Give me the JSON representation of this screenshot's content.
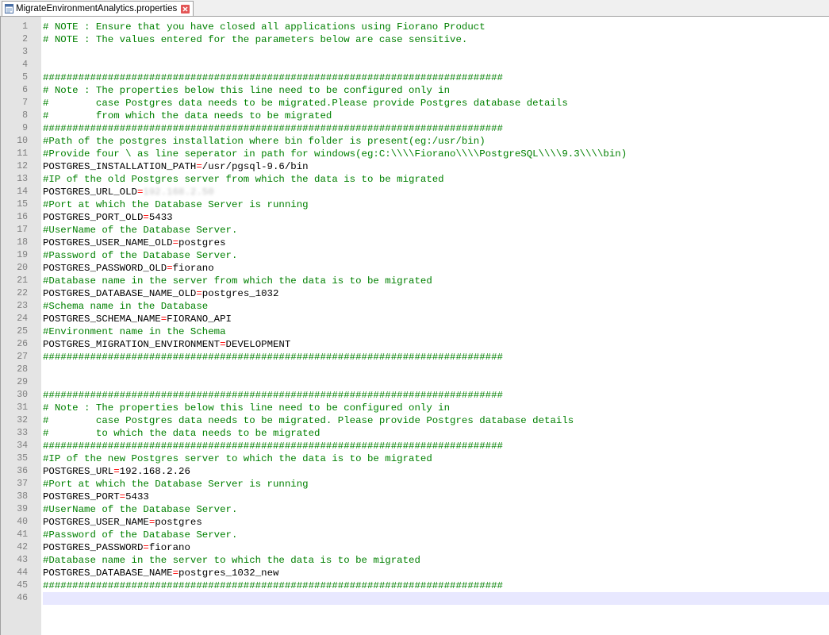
{
  "tab": {
    "filename": "MigrateEnvironmentAnalytics.properties",
    "file_icon": "properties-file-icon",
    "close_icon": "close-icon"
  },
  "editor": {
    "current_line": 46,
    "lines": [
      {
        "n": "1",
        "type": "comment",
        "text": "# NOTE : Ensure that you have closed all applications using Fiorano Product"
      },
      {
        "n": "2",
        "type": "comment",
        "text": "# NOTE : The values entered for the parameters below are case sensitive."
      },
      {
        "n": "3",
        "type": "blank",
        "text": ""
      },
      {
        "n": "4",
        "type": "blank",
        "text": ""
      },
      {
        "n": "5",
        "type": "comment",
        "text": "##############################################################################"
      },
      {
        "n": "6",
        "type": "comment",
        "text": "# Note : The properties below this line need to be configured only in"
      },
      {
        "n": "7",
        "type": "comment",
        "text": "#        case Postgres data needs to be migrated.Please provide Postgres database details"
      },
      {
        "n": "8",
        "type": "comment",
        "text": "#        from which the data needs to be migrated"
      },
      {
        "n": "9",
        "type": "comment",
        "text": "##############################################################################"
      },
      {
        "n": "10",
        "type": "comment",
        "text": "#Path of the postgres installation where bin folder is present(eg:/usr/bin)"
      },
      {
        "n": "11",
        "type": "comment",
        "text": "#Provide four \\ as line seperator in path for windows(eg:C:\\\\\\\\Fiorano\\\\\\\\PostgreSQL\\\\\\\\9.3\\\\\\\\bin)"
      },
      {
        "n": "12",
        "type": "prop",
        "key": "POSTGRES_INSTALLATION_PATH",
        "value": "/usr/pgsql-9.6/bin"
      },
      {
        "n": "13",
        "type": "comment",
        "text": "#IP of the old Postgres server from which the data is to be migrated"
      },
      {
        "n": "14",
        "type": "prop",
        "key": "POSTGRES_URL_OLD",
        "value": "192.168.2.50",
        "blurred": true
      },
      {
        "n": "15",
        "type": "comment",
        "text": "#Port at which the Database Server is running"
      },
      {
        "n": "16",
        "type": "prop",
        "key": "POSTGRES_PORT_OLD",
        "value": "5433"
      },
      {
        "n": "17",
        "type": "comment",
        "text": "#UserName of the Database Server."
      },
      {
        "n": "18",
        "type": "prop",
        "key": "POSTGRES_USER_NAME_OLD",
        "value": "postgres"
      },
      {
        "n": "19",
        "type": "comment",
        "text": "#Password of the Database Server."
      },
      {
        "n": "20",
        "type": "prop",
        "key": "POSTGRES_PASSWORD_OLD",
        "value": "fiorano"
      },
      {
        "n": "21",
        "type": "comment",
        "text": "#Database name in the server from which the data is to be migrated"
      },
      {
        "n": "22",
        "type": "prop",
        "key": "POSTGRES_DATABASE_NAME_OLD",
        "value": "postgres_1032"
      },
      {
        "n": "23",
        "type": "comment",
        "text": "#Schema name in the Database"
      },
      {
        "n": "24",
        "type": "prop",
        "key": "POSTGRES_SCHEMA_NAME",
        "value": "FIORANO_API"
      },
      {
        "n": "25",
        "type": "comment",
        "text": "#Environment name in the Schema"
      },
      {
        "n": "26",
        "type": "prop",
        "key": "POSTGRES_MIGRATION_ENVIRONMENT",
        "value": "DEVELOPMENT"
      },
      {
        "n": "27",
        "type": "comment",
        "text": "##############################################################################"
      },
      {
        "n": "28",
        "type": "blank",
        "text": ""
      },
      {
        "n": "29",
        "type": "blank",
        "text": ""
      },
      {
        "n": "30",
        "type": "comment",
        "text": "##############################################################################"
      },
      {
        "n": "31",
        "type": "comment",
        "text": "# Note : The properties below this line need to be configured only in"
      },
      {
        "n": "32",
        "type": "comment",
        "text": "#        case Postgres data needs to be migrated. Please provide Postgres database details"
      },
      {
        "n": "33",
        "type": "comment",
        "text": "#        to which the data needs to be migrated"
      },
      {
        "n": "34",
        "type": "comment",
        "text": "##############################################################################"
      },
      {
        "n": "35",
        "type": "comment",
        "text": "#IP of the new Postgres server to which the data is to be migrated"
      },
      {
        "n": "36",
        "type": "prop",
        "key": "POSTGRES_URL",
        "value": "192.168.2.26"
      },
      {
        "n": "37",
        "type": "comment",
        "text": "#Port at which the Database Server is running"
      },
      {
        "n": "38",
        "type": "prop",
        "key": "POSTGRES_PORT",
        "value": "5433"
      },
      {
        "n": "39",
        "type": "comment",
        "text": "#UserName of the Database Server."
      },
      {
        "n": "40",
        "type": "prop",
        "key": "POSTGRES_USER_NAME",
        "value": "postgres"
      },
      {
        "n": "41",
        "type": "comment",
        "text": "#Password of the Database Server."
      },
      {
        "n": "42",
        "type": "prop",
        "key": "POSTGRES_PASSWORD",
        "value": "fiorano"
      },
      {
        "n": "43",
        "type": "comment",
        "text": "#Database name in the server to which the data is to be migrated"
      },
      {
        "n": "44",
        "type": "prop",
        "key": "POSTGRES_DATABASE_NAME",
        "value": "postgres_1032_new"
      },
      {
        "n": "45",
        "type": "comment",
        "text": "##############################################################################"
      },
      {
        "n": "46",
        "type": "blank",
        "text": ""
      }
    ]
  },
  "colors": {
    "comment": "#008000",
    "key": "#000000",
    "operator": "#ff0000",
    "line_number": "#808080",
    "gutter_bg": "#e4e4e4",
    "current_line_bg": "#e8e8ff"
  }
}
